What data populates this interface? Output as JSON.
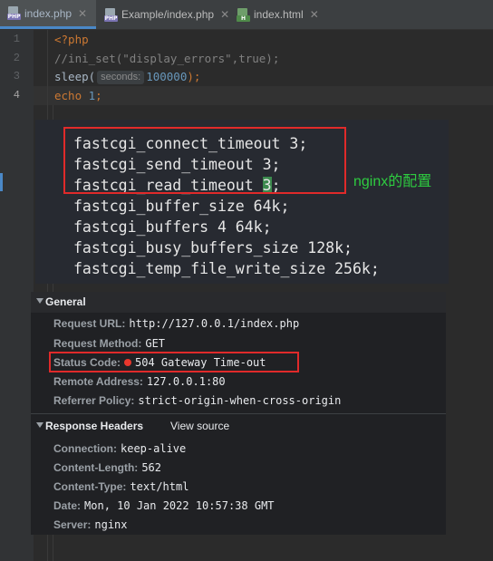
{
  "tabs": [
    {
      "label": "index.php",
      "icon": "php-file-icon",
      "badge": "PHP",
      "active": true
    },
    {
      "label": "Example/index.php",
      "icon": "php-file-icon",
      "badge": "PHP",
      "active": false
    },
    {
      "label": "index.html",
      "icon": "html-file-icon",
      "badge": "H",
      "active": false
    }
  ],
  "editor": {
    "line_numbers": [
      "1",
      "2",
      "3",
      "4"
    ],
    "line1": "<?php",
    "line2": "//ini_set(\"display_errors\",true);",
    "line3_fn": "sleep(",
    "line3_hint": "seconds:",
    "line3_arg": "100000",
    "line3_end": ");",
    "line4_kw": "echo",
    "line4_num": "1",
    "line4_end": ";"
  },
  "nginx": {
    "lines": [
      "fastcgi_connect_timeout 3;",
      "fastcgi_send_timeout 3;",
      "fastcgi_read_timeout ",
      "fastcgi_buffer_size 64k;",
      "fastcgi_buffers 4 64k;",
      "fastcgi_busy_buffers_size 128k;",
      "fastcgi_temp_file_write_size 256k;"
    ],
    "read_timeout_value": "3",
    "read_timeout_end": ";",
    "caption": "nginx的配置"
  },
  "devtools": {
    "general_title": "General",
    "general": [
      {
        "key": "Request URL:",
        "value": "http://127.0.0.1/index.php"
      },
      {
        "key": "Request Method:",
        "value": "GET"
      },
      {
        "key": "Status Code:",
        "value": "504 Gateway Time-out",
        "status_dot_color": "#e8372d"
      },
      {
        "key": "Remote Address:",
        "value": "127.0.0.1:80"
      },
      {
        "key": "Referrer Policy:",
        "value": "strict-origin-when-cross-origin"
      }
    ],
    "response_title": "Response Headers",
    "view_source": "View source",
    "response": [
      {
        "key": "Connection:",
        "value": "keep-alive"
      },
      {
        "key": "Content-Length:",
        "value": "562"
      },
      {
        "key": "Content-Type:",
        "value": "text/html"
      },
      {
        "key": "Date:",
        "value": "Mon, 10 Jan 2022 10:57:38 GMT"
      },
      {
        "key": "Server:",
        "value": "nginx"
      }
    ]
  },
  "colors": {
    "highlight_box": "#e02a2a",
    "caption": "#2ecc40",
    "active_tab_underline": "#4a88c7"
  }
}
